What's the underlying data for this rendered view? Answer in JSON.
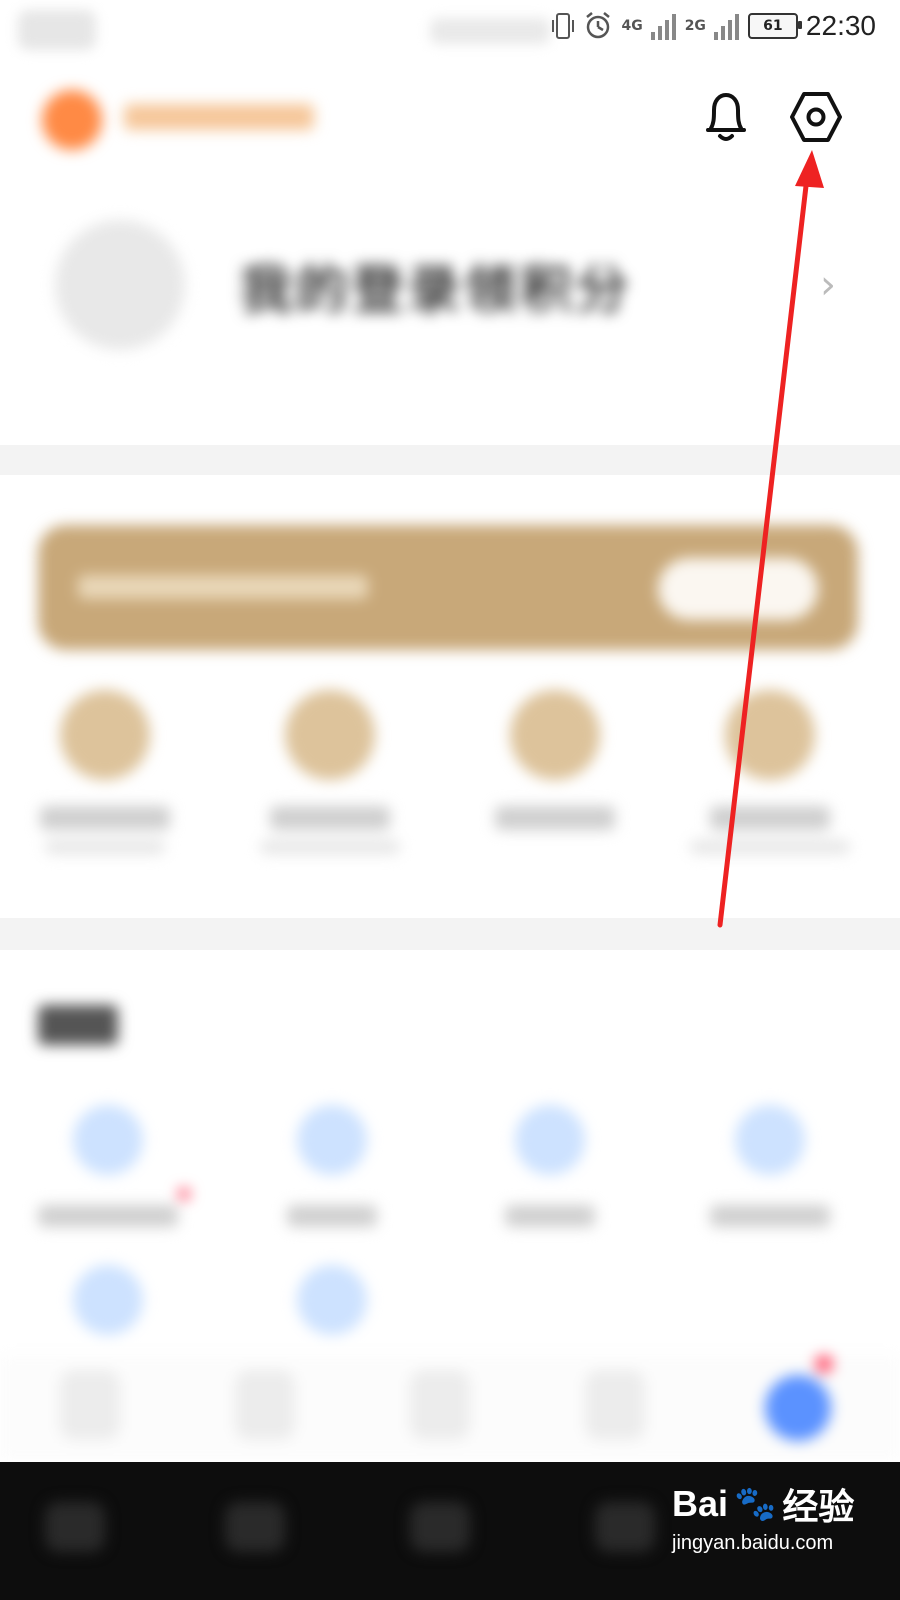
{
  "status_bar": {
    "network_4g": "4G",
    "network_2g": "2G",
    "battery_level": "61",
    "time": "22:30"
  },
  "profile": {
    "name_text": "我的登录领积分"
  },
  "watermark": {
    "brand_left": "Bai",
    "brand_right": "经验",
    "url": "jingyan.baidu.com"
  },
  "colors": {
    "accent_gold": "#c8a879",
    "arrow_red": "#ee2222",
    "tab_active": "#5b92ff"
  }
}
